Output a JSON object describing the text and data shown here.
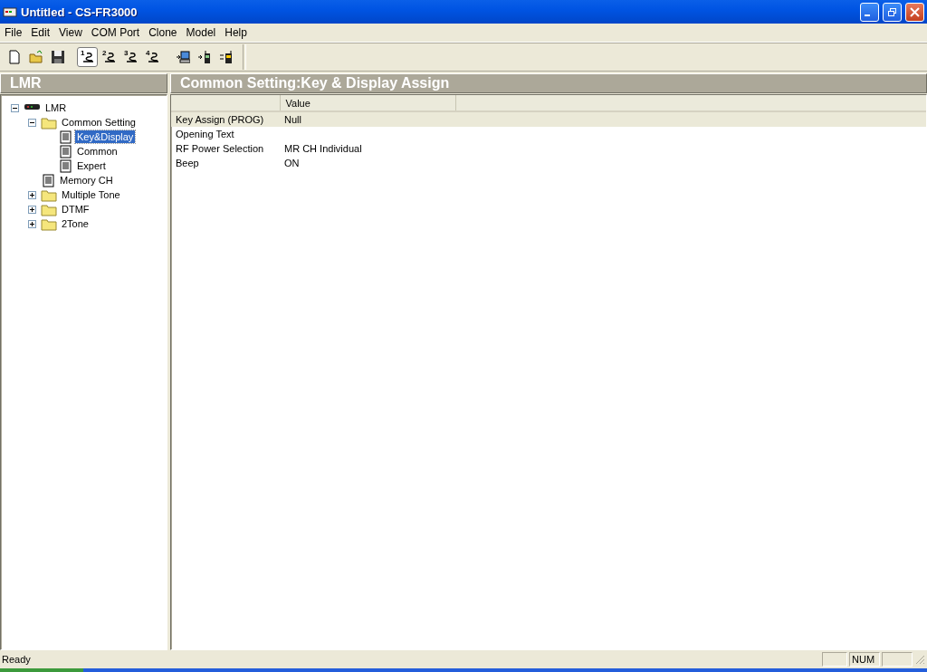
{
  "window": {
    "title": "Untitled - CS-FR3000"
  },
  "menu": [
    "File",
    "Edit",
    "View",
    "COM Port",
    "Clone",
    "Model",
    "Help"
  ],
  "toolbar": [
    {
      "kind": "new",
      "selected": false
    },
    {
      "kind": "open",
      "selected": false
    },
    {
      "kind": "save",
      "selected": false
    },
    {
      "kind": "port",
      "label": "1",
      "selected": true
    },
    {
      "kind": "port",
      "label": "2",
      "selected": false
    },
    {
      "kind": "port",
      "label": "3",
      "selected": false
    },
    {
      "kind": "port",
      "label": "4",
      "selected": false
    },
    {
      "kind": "to-pc",
      "selected": false
    },
    {
      "kind": "to-radio",
      "selected": false
    },
    {
      "kind": "radio-swap",
      "selected": false
    }
  ],
  "left_pane": {
    "title": "LMR"
  },
  "tree": [
    {
      "label": "LMR",
      "kind": "radio",
      "expanded": true,
      "selected": false,
      "children": [
        {
          "label": "Common Setting",
          "kind": "folder",
          "expanded": true,
          "selected": false,
          "children": [
            {
              "label": "Key&Display",
              "kind": "page",
              "selected": true
            },
            {
              "label": "Common",
              "kind": "page",
              "selected": false
            },
            {
              "label": "Expert",
              "kind": "page",
              "selected": false
            }
          ]
        },
        {
          "label": "Memory CH",
          "kind": "page",
          "selected": false
        },
        {
          "label": "Multiple Tone",
          "kind": "folder",
          "expanded": false,
          "selected": false
        },
        {
          "label": "DTMF",
          "kind": "folder",
          "expanded": false,
          "selected": false
        },
        {
          "label": "2Tone",
          "kind": "folder",
          "expanded": false,
          "selected": false
        }
      ]
    }
  ],
  "right_pane": {
    "title": "Common Setting:Key & Display Assign"
  },
  "table": {
    "columns": [
      "Value"
    ],
    "rows": [
      {
        "name": "Key Assign (PROG)",
        "value": "Null",
        "selected": true
      },
      {
        "name": "Opening Text",
        "value": "",
        "selected": false
      },
      {
        "name": "RF Power Selection",
        "value": "MR CH Individual",
        "selected": false
      },
      {
        "name": "Beep",
        "value": "ON",
        "selected": false
      }
    ]
  },
  "status_bar": {
    "text": "Ready",
    "num_indicator": "NUM"
  }
}
